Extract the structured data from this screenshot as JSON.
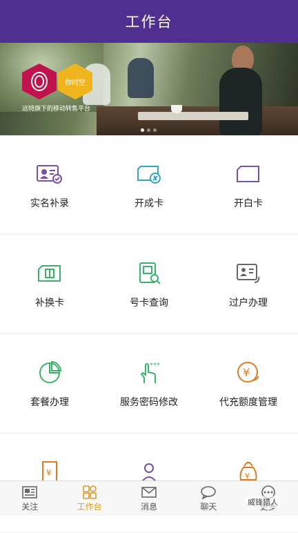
{
  "header": {
    "title": "工作台"
  },
  "banner": {
    "badge_text": "你时空",
    "slogan": "远特旗下的移动转售平台",
    "dot_count": 3,
    "active_dot": 0
  },
  "features": [
    [
      {
        "label": "实名补录",
        "icon": "id-card-check-icon",
        "color": "#7b4fa8"
      },
      {
        "label": "开成卡",
        "icon": "sim-card-link-icon",
        "color": "#2fa6c4"
      },
      {
        "label": "开白卡",
        "icon": "blank-sim-card-icon",
        "color": "#7b4fa8"
      }
    ],
    [
      {
        "label": "补换卡",
        "icon": "replace-sim-card-icon",
        "color": "#39b268"
      },
      {
        "label": "号卡查询",
        "icon": "sim-search-icon",
        "color": "#39b268"
      },
      {
        "label": "过户办理",
        "icon": "transfer-id-icon",
        "color": "#666666"
      }
    ],
    [
      {
        "label": "套餐办理",
        "icon": "pie-chart-icon",
        "color": "#39b268"
      },
      {
        "label": "服务密码修改",
        "icon": "touch-password-icon",
        "color": "#39b268"
      },
      {
        "label": "代充额度管理",
        "icon": "yuan-coin-icon",
        "color": "#e07a1f"
      }
    ]
  ],
  "tabs": [
    {
      "label": "关注",
      "icon": "dashboard-icon"
    },
    {
      "label": "工作台",
      "icon": "grid-icon"
    },
    {
      "label": "消息",
      "icon": "envelope-icon"
    },
    {
      "label": "聊天",
      "icon": "chat-bubble-icon"
    },
    {
      "label": "更多",
      "icon": "more-icon"
    }
  ],
  "active_tab": "工作台",
  "watermark": "威锋猎人",
  "colors": {
    "header": "#4f2f8f",
    "active_tab": "#d79a1e"
  }
}
